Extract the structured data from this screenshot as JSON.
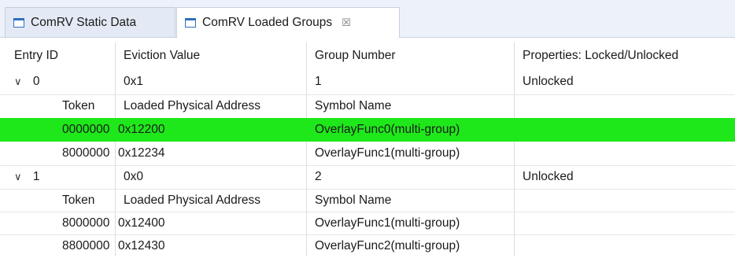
{
  "tabs": [
    {
      "label": "ComRV Static Data"
    },
    {
      "label": "ComRV Loaded Groups",
      "close_glyph": "☒"
    }
  ],
  "columns": [
    "Entry ID",
    "Eviction Value",
    "Group Number",
    "Properties: Locked/Unlocked"
  ],
  "groups": [
    {
      "entry_id": "0",
      "eviction": "0x1",
      "group_number": "1",
      "properties": "Unlocked",
      "sub_header": {
        "token": "Token",
        "address": "Loaded Physical Address",
        "symbol": "Symbol Name"
      },
      "rows": [
        {
          "token": "0000000",
          "address": "0x12200",
          "symbol": "OverlayFunc0(multi-group)",
          "selected": true
        },
        {
          "token": "8000000",
          "address": "0x12234",
          "symbol": "OverlayFunc1(multi-group)",
          "selected": false
        }
      ]
    },
    {
      "entry_id": "1",
      "eviction": "0x0",
      "group_number": "2",
      "properties": "Unlocked",
      "sub_header": {
        "token": "Token",
        "address": "Loaded Physical Address",
        "symbol": "Symbol Name"
      },
      "rows": [
        {
          "token": "8000000",
          "address": "0x12400",
          "symbol": "OverlayFunc1(multi-group)",
          "selected": false
        },
        {
          "token": "8800000",
          "address": "0x12430",
          "symbol": "OverlayFunc2(multi-group)",
          "selected": false
        }
      ]
    }
  ],
  "icons": {
    "expand": "chevron-down-icon",
    "tab": "table-icon",
    "close": "close-icon"
  },
  "colors": {
    "selection": "#1fe81a",
    "tab_icon": "#2f6fbf"
  }
}
